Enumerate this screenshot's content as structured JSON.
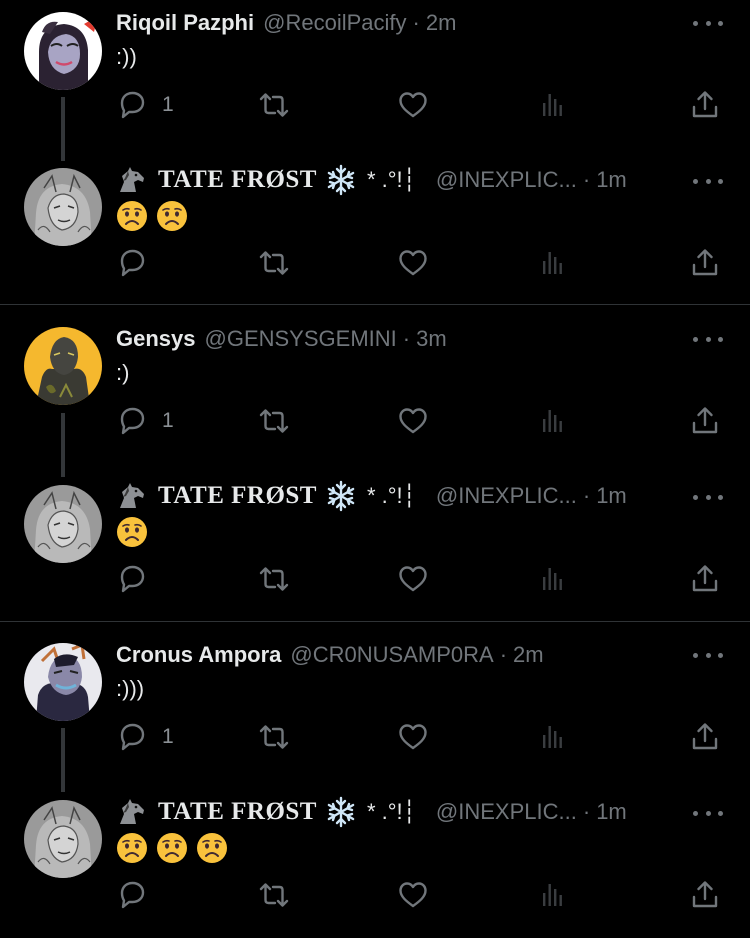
{
  "tweets": [
    {
      "name": "Riqoil Pazphi",
      "handle": "@RecoilPacify",
      "time": "2m",
      "text": ":))",
      "reply_count": "1",
      "avatar": "anime-character-red-horn-avatar"
    },
    {
      "name": "TATE FRØST",
      "handle": "@INEXPLIC...",
      "time": "1m",
      "deco": "* .°!┆",
      "emojis": [
        "worried-face",
        "worried-face"
      ],
      "reply_count": "",
      "avatar": "sketch-character-avatar"
    },
    {
      "name": "Gensys",
      "handle": "@GENSYSGEMINI",
      "time": "3m",
      "text": ":)",
      "reply_count": "1",
      "avatar": "anime-character-yellow-background-avatar"
    },
    {
      "name": "TATE FRØST",
      "handle": "@INEXPLIC...",
      "time": "1m",
      "deco": "* .°!┆",
      "emojis": [
        "worried-face"
      ],
      "reply_count": "",
      "avatar": "sketch-character-avatar"
    },
    {
      "name": "Cronus Ampora",
      "handle": "@CR0NUSAMP0RA",
      "time": "2m",
      "text": ":)))",
      "reply_count": "1",
      "avatar": "anime-character-purple-horns-avatar"
    },
    {
      "name": "TATE FRØST",
      "handle": "@INEXPLIC...",
      "time": "1m",
      "deco": "* .°!┆",
      "emojis": [
        "worried-face",
        "worried-face",
        "worried-face"
      ],
      "reply_count": "",
      "avatar": "sketch-character-avatar"
    }
  ],
  "icons": {
    "reply": "reply-icon",
    "retweet": "retweet-icon",
    "like": "like-icon",
    "analytics": "analytics-icon",
    "share": "share-icon",
    "more": "more-icon",
    "snowflake": "snowflake-icon",
    "horse": "horse-icon"
  },
  "colors": {
    "background": "#000000",
    "text": "#e7e9ea",
    "secondary": "#71767b",
    "divider": "#2f3336",
    "emoji": "#f9c23c"
  }
}
